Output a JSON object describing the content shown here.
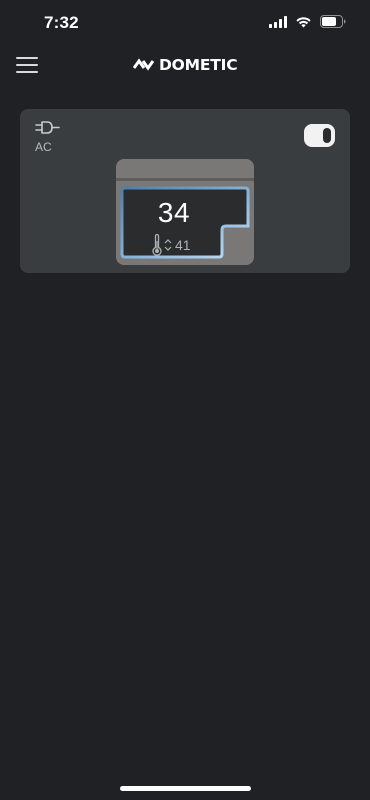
{
  "status_bar": {
    "time": "7:32",
    "signal_icon": "cellular-signal-icon",
    "wifi_icon": "wifi-icon",
    "battery_icon": "battery-icon"
  },
  "header": {
    "menu_icon": "hamburger-menu-icon",
    "logo_text": "DOMETIC",
    "logo_icon": "dometic-logo-icon"
  },
  "device": {
    "power_source_icon": "power-plug-icon",
    "power_source": "AC",
    "power_on": true,
    "current_temperature": "34",
    "setpoint_icon": "thermometer-icon",
    "setpoint_adjust_icon": "up-down-arrows-icon",
    "setpoint": "41"
  },
  "colors": {
    "background": "#1f2124",
    "card": "#3a3d40",
    "fridge_body": "#7a7877",
    "compartment_glow": "#8fbbe0"
  }
}
